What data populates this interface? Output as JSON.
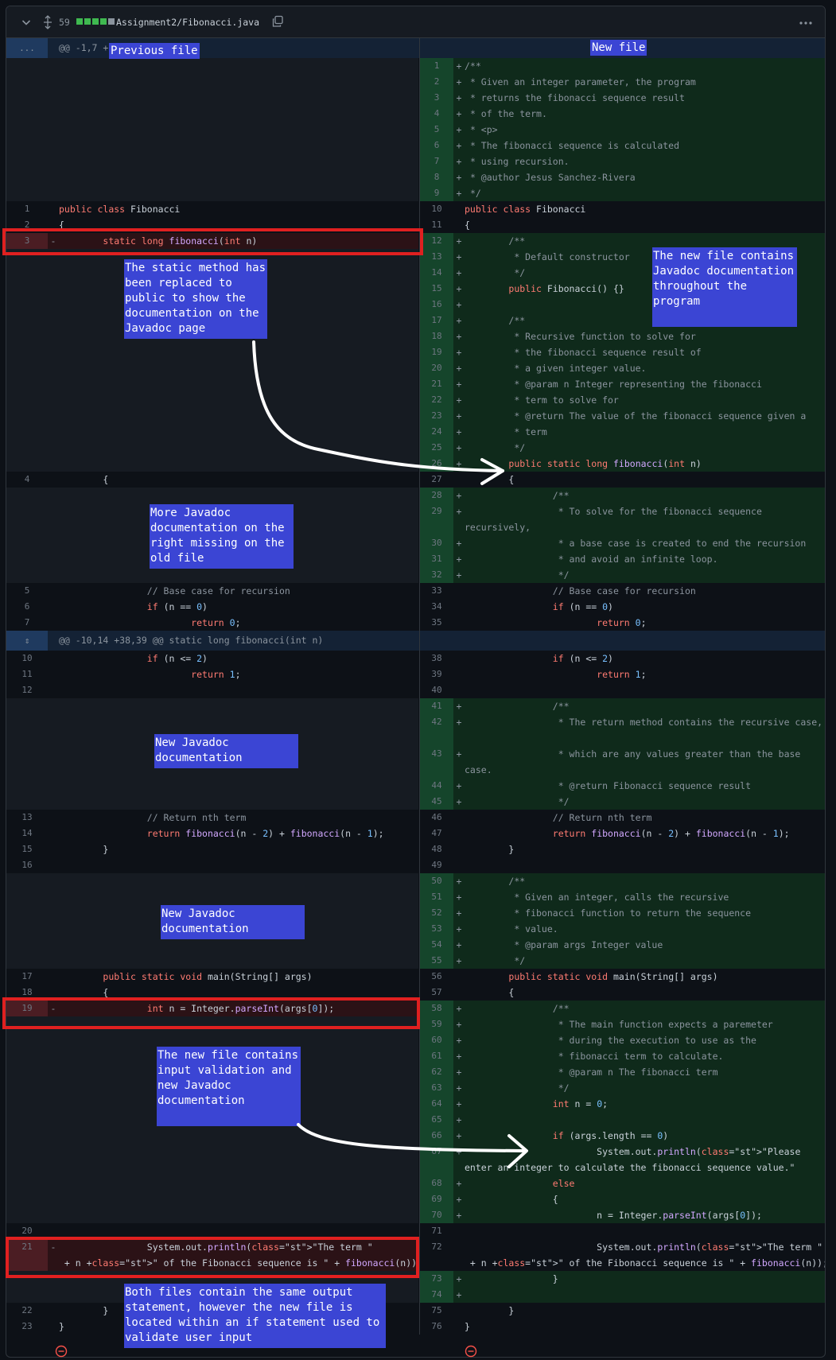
{
  "file": {
    "additions": "59",
    "path": "Assignment2/Fibonacci.java",
    "bar_colors": [
      "#3fb950",
      "#3fb950",
      "#3fb950",
      "#3fb950",
      "#8b949e"
    ]
  },
  "hunks": [
    {
      "header": "@@ -1,7 +1",
      "expand_label": "..."
    },
    {
      "header": "@@ -10,14 +38,39 @@ static long fibonacci(int n)"
    }
  ],
  "labels": {
    "previous_file": "Previous file",
    "new_file": "New file"
  },
  "annotations": {
    "static_method": "The static method has been replaced to public to show the documentation on the Javadoc page",
    "new_file_javadoc": "The new file contains Javadoc documentation throughout the program",
    "more_javadoc": "More Javadoc documentation on the right missing on the old file",
    "new_javadoc_1": "New Javadoc documentation",
    "new_javadoc_2": "New Javadoc documentation",
    "input_validation": "The new file contains input validation and new Javadoc documentation",
    "both_files": "Both files contain the same output statement, however the new file is located within an if statement used to validate user input"
  },
  "left": [
    {
      "n": "1",
      "code": "public class Fibonacci"
    },
    {
      "n": "2",
      "code": "{"
    },
    {
      "n": "3",
      "code": "        static long fibonacci(int n)",
      "sign": "-"
    },
    {
      "n": "4",
      "code": "        {"
    },
    {
      "n": "5",
      "code": "                // Base case for recursion"
    },
    {
      "n": "6",
      "code": "                if (n == 0)"
    },
    {
      "n": "7",
      "code": "                        return 0;"
    },
    {
      "n": "10",
      "code": "                if (n <= 2)"
    },
    {
      "n": "11",
      "code": "                        return 1;"
    },
    {
      "n": "12",
      "code": ""
    },
    {
      "n": "13",
      "code": "                // Return nth term"
    },
    {
      "n": "14",
      "code": "                return fibonacci(n - 2) + fibonacci(n - 1);"
    },
    {
      "n": "15",
      "code": "        }"
    },
    {
      "n": "16",
      "code": ""
    },
    {
      "n": "17",
      "code": "        public static void main(String[] args)"
    },
    {
      "n": "18",
      "code": "        {"
    },
    {
      "n": "19",
      "code": "                int n = Integer.parseInt(args[0]);",
      "sign": "-"
    },
    {
      "n": "20",
      "code": ""
    },
    {
      "n": "21",
      "code": "                System.out.println(\"The term \" + n +\" of the Fibonacci sequence is \" + fibonacci(n));",
      "sign": "-"
    },
    {
      "n": "22",
      "code": "        }"
    },
    {
      "n": "23",
      "code": "}"
    }
  ],
  "right": [
    {
      "n": "1",
      "code": "/**",
      "sign": "+"
    },
    {
      "n": "2",
      "code": " * Given an integer parameter, the program",
      "sign": "+"
    },
    {
      "n": "3",
      "code": " * returns the fibonacci sequence result",
      "sign": "+"
    },
    {
      "n": "4",
      "code": " * of the term.",
      "sign": "+"
    },
    {
      "n": "5",
      "code": " * <p>",
      "sign": "+"
    },
    {
      "n": "6",
      "code": " * The fibonacci sequence is calculated",
      "sign": "+"
    },
    {
      "n": "7",
      "code": " * using recursion.",
      "sign": "+"
    },
    {
      "n": "8",
      "code": " * @author Jesus Sanchez-Rivera",
      "sign": "+"
    },
    {
      "n": "9",
      "code": " */",
      "sign": "+"
    },
    {
      "n": "10",
      "code": "public class Fibonacci"
    },
    {
      "n": "11",
      "code": "{"
    },
    {
      "n": "12",
      "code": "        /**",
      "sign": "+"
    },
    {
      "n": "13",
      "code": "         * Default constructor",
      "sign": "+"
    },
    {
      "n": "14",
      "code": "         */",
      "sign": "+"
    },
    {
      "n": "15",
      "code": "        public Fibonacci() {}",
      "sign": "+"
    },
    {
      "n": "16",
      "code": "",
      "sign": "+"
    },
    {
      "n": "17",
      "code": "        /**",
      "sign": "+"
    },
    {
      "n": "18",
      "code": "         * Recursive function to solve for",
      "sign": "+"
    },
    {
      "n": "19",
      "code": "         * the fibonacci sequence result of",
      "sign": "+"
    },
    {
      "n": "20",
      "code": "         * a given integer value.",
      "sign": "+"
    },
    {
      "n": "21",
      "code": "         * @param n Integer representing the fibonacci",
      "sign": "+"
    },
    {
      "n": "22",
      "code": "         * term to solve for",
      "sign": "+"
    },
    {
      "n": "23",
      "code": "         * @return The value of the fibonacci sequence given a",
      "sign": "+"
    },
    {
      "n": "24",
      "code": "         * term",
      "sign": "+"
    },
    {
      "n": "25",
      "code": "         */",
      "sign": "+"
    },
    {
      "n": "26",
      "code": "        public static long fibonacci(int n)",
      "sign": "+"
    },
    {
      "n": "27",
      "code": "        {"
    },
    {
      "n": "28",
      "code": "                /**",
      "sign": "+"
    },
    {
      "n": "29",
      "code": "                 * To solve for the fibonacci sequence recursively,",
      "sign": "+"
    },
    {
      "n": "30",
      "code": "                 * a base case is created to end the recursion",
      "sign": "+"
    },
    {
      "n": "31",
      "code": "                 * and avoid an infinite loop.",
      "sign": "+"
    },
    {
      "n": "32",
      "code": "                 */",
      "sign": "+"
    },
    {
      "n": "33",
      "code": "                // Base case for recursion"
    },
    {
      "n": "34",
      "code": "                if (n == 0)"
    },
    {
      "n": "35",
      "code": "                        return 0;"
    },
    {
      "n": "38",
      "code": "                if (n <= 2)"
    },
    {
      "n": "39",
      "code": "                        return 1;"
    },
    {
      "n": "40",
      "code": ""
    },
    {
      "n": "41",
      "code": "                /**",
      "sign": "+"
    },
    {
      "n": "42",
      "code": "                 * The return method contains the recursive case,",
      "sign": "+"
    },
    {
      "n": "43",
      "code": "                 * which are any values greater than the base case.",
      "sign": "+"
    },
    {
      "n": "44",
      "code": "                 * @return Fibonacci sequence result",
      "sign": "+"
    },
    {
      "n": "45",
      "code": "                 */",
      "sign": "+"
    },
    {
      "n": "46",
      "code": "                // Return nth term"
    },
    {
      "n": "47",
      "code": "                return fibonacci(n - 2) + fibonacci(n - 1);"
    },
    {
      "n": "48",
      "code": "        }"
    },
    {
      "n": "49",
      "code": ""
    },
    {
      "n": "50",
      "code": "        /**",
      "sign": "+"
    },
    {
      "n": "51",
      "code": "         * Given an integer, calls the recursive",
      "sign": "+"
    },
    {
      "n": "52",
      "code": "         * fibonacci function to return the sequence",
      "sign": "+"
    },
    {
      "n": "53",
      "code": "         * value.",
      "sign": "+"
    },
    {
      "n": "54",
      "code": "         * @param args Integer value",
      "sign": "+"
    },
    {
      "n": "55",
      "code": "         */",
      "sign": "+"
    },
    {
      "n": "56",
      "code": "        public static void main(String[] args)"
    },
    {
      "n": "57",
      "code": "        {"
    },
    {
      "n": "58",
      "code": "                /**",
      "sign": "+"
    },
    {
      "n": "59",
      "code": "                 * The main function expects a paremeter",
      "sign": "+"
    },
    {
      "n": "60",
      "code": "                 * during the execution to use as the",
      "sign": "+"
    },
    {
      "n": "61",
      "code": "                 * fibonacci term to calculate.",
      "sign": "+"
    },
    {
      "n": "62",
      "code": "                 * @param n The fibonacci term",
      "sign": "+"
    },
    {
      "n": "63",
      "code": "                 */",
      "sign": "+"
    },
    {
      "n": "64",
      "code": "                int n = 0;",
      "sign": "+"
    },
    {
      "n": "65",
      "code": "",
      "sign": "+"
    },
    {
      "n": "66",
      "code": "                if (args.length == 0)",
      "sign": "+"
    },
    {
      "n": "67",
      "code": "                        System.out.println(\"Please enter an integer to calculate the fibonacci sequence value.\");",
      "sign": "+"
    },
    {
      "n": "68",
      "code": "                else",
      "sign": "+"
    },
    {
      "n": "69",
      "code": "                {",
      "sign": "+"
    },
    {
      "n": "70",
      "code": "                        n = Integer.parseInt(args[0]);",
      "sign": "+"
    },
    {
      "n": "71",
      "code": ""
    },
    {
      "n": "72",
      "code": "                        System.out.println(\"The term \" + n +\" of the Fibonacci sequence is \" + fibonacci(n));"
    },
    {
      "n": "73",
      "code": "                }",
      "sign": "+"
    },
    {
      "n": "74",
      "code": "",
      "sign": "+"
    },
    {
      "n": "75",
      "code": "        }"
    },
    {
      "n": "76",
      "code": "}"
    }
  ]
}
